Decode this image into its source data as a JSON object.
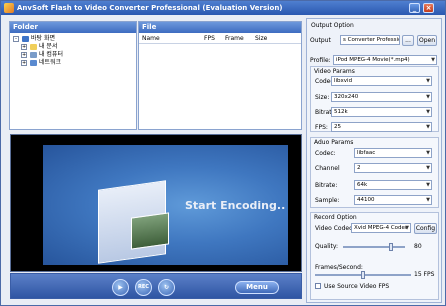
{
  "window": {
    "title": "AnvSoft Flash to Video Converter Professional (Evaluation Version)"
  },
  "folder_panel": {
    "header": "Folder",
    "items": [
      {
        "label": "바탕 화면",
        "expand": "-"
      },
      {
        "label": "내 문서",
        "expand": "+"
      },
      {
        "label": "내 컴퓨터",
        "expand": "+"
      },
      {
        "label": "네트워크",
        "expand": "+"
      }
    ]
  },
  "file_panel": {
    "header": "File",
    "columns": [
      "Name",
      "FPS",
      "Frame",
      "Size"
    ]
  },
  "preview": {
    "text": "Start Encoding.."
  },
  "controls": {
    "play": "▶",
    "rec": "REC",
    "menu_label": "Menu"
  },
  "output_option": {
    "title": "Output Option",
    "output_label": "Output",
    "output_value": "s Converter Professional",
    "browse_label": "...",
    "open_label": "Open",
    "profile_label": "Profile:",
    "profile_value": "iPod MPEG-4 Movie(*.mp4)"
  },
  "video_params": {
    "title": "Video Params",
    "codec_label": "Codec:",
    "codec": "libxvid",
    "size_label": "Size:",
    "size": "320x240",
    "bitrate_label": "Bitrate:",
    "bitrate": "512k",
    "fps_label": "FPS:",
    "fps": "25"
  },
  "audio_params": {
    "title": "Aduo Params",
    "codec_label": "Codec:",
    "codec": "libfaac",
    "channel_label": "Channel",
    "channel": "2",
    "bitrate_label": "Bitrate:",
    "bitrate": "64k",
    "sample_label": "Sample:",
    "sample": "44100"
  },
  "record_option": {
    "title": "Record Option",
    "codec_label": "Video Codec",
    "codec": "Xvid MPEG-4 Codec",
    "config_label": "Config",
    "quality_label": "Quality:",
    "quality": "80",
    "quality_level": 0.8,
    "fps_label": "Frames/Second:",
    "fps": "15 FPS",
    "fps_level": 0.5,
    "use_source_label": "Use Source Video FPS"
  }
}
